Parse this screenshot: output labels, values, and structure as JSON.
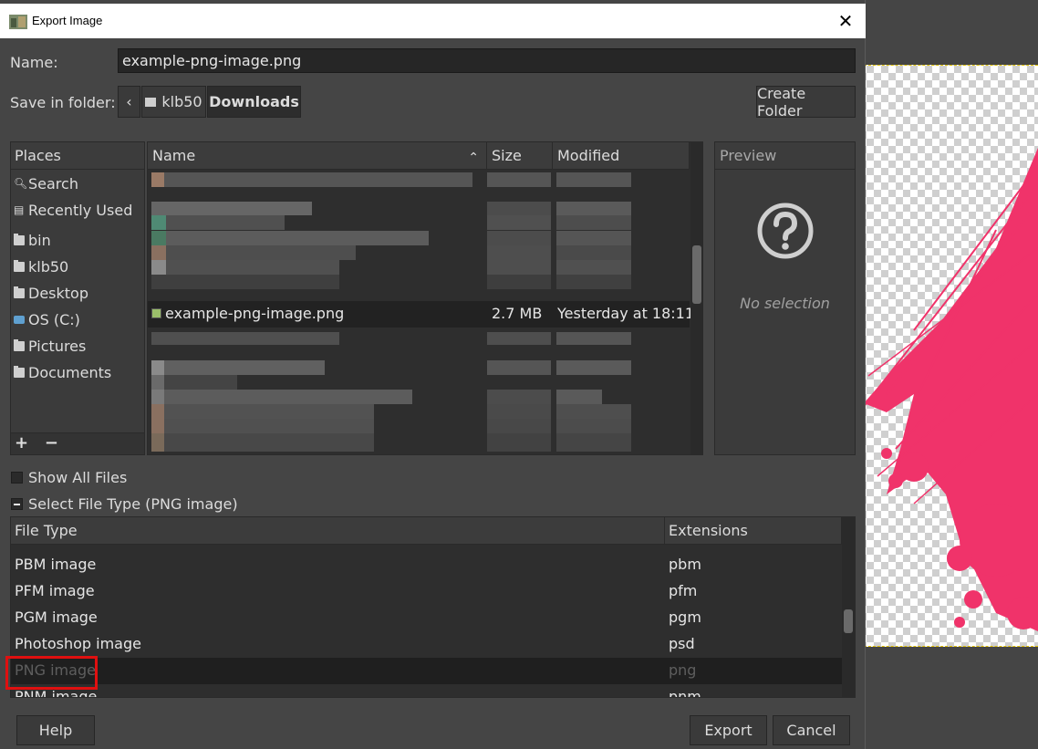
{
  "window": {
    "title": "Export Image",
    "close_label": "✕"
  },
  "name_row": {
    "label": "Name:",
    "value": "example-png-image.png"
  },
  "save_row": {
    "label": "Save in folder:",
    "back_label": "‹",
    "crumbs": [
      "klb50",
      "Downloads"
    ],
    "create_folder": "Create Folder"
  },
  "places": {
    "header": "Places",
    "items": [
      {
        "label": "Search",
        "icon": "search-icon"
      },
      {
        "label": "Recently Used",
        "icon": "recent-icon"
      },
      {
        "label": "bin",
        "icon": "folder-icon"
      },
      {
        "label": "klb50",
        "icon": "folder-icon"
      },
      {
        "label": "Desktop",
        "icon": "folder-icon"
      },
      {
        "label": "OS (C:)",
        "icon": "drive-icon"
      },
      {
        "label": "Pictures",
        "icon": "folder-icon"
      },
      {
        "label": "Documents",
        "icon": "folder-icon"
      }
    ],
    "add_label": "+",
    "remove_label": "−"
  },
  "files": {
    "headers": {
      "name": "Name",
      "size": "Size",
      "modified": "Modified"
    },
    "sort_indicator": "⌃",
    "selected": {
      "name": "example-png-image.png",
      "size": "2.7 MB",
      "modified": "Yesterday at 18:11"
    }
  },
  "preview": {
    "header": "Preview",
    "placeholder": "No selection"
  },
  "options": {
    "show_all_files": "Show All Files",
    "select_file_type": "Select File Type (PNG image)"
  },
  "file_types": {
    "headers": {
      "type": "File Type",
      "ext": "Extensions"
    },
    "rows": [
      {
        "type": "PBM image",
        "ext": "pbm"
      },
      {
        "type": "PFM image",
        "ext": "pfm"
      },
      {
        "type": "PGM image",
        "ext": "pgm"
      },
      {
        "type": "Photoshop image",
        "ext": "psd"
      },
      {
        "type": "PNG image",
        "ext": "png"
      },
      {
        "type": "PNM image",
        "ext": "pnm"
      }
    ]
  },
  "buttons": {
    "help": "Help",
    "export": "Export",
    "cancel": "Cancel"
  },
  "colors": {
    "accent_highlight": "#e01010",
    "canvas_paint": "#f0336a"
  }
}
